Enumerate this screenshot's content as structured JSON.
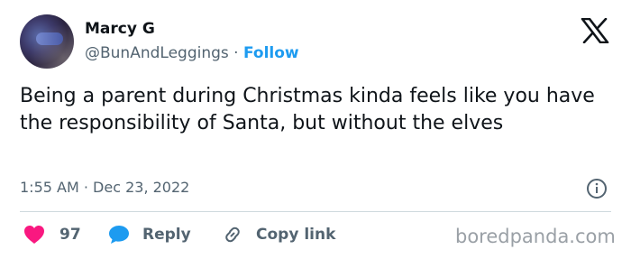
{
  "author": {
    "name": "Marcy G",
    "handle": "@BunAndLeggings",
    "separator": "·",
    "follow_label": "Follow"
  },
  "tweet": {
    "text": "Being a parent during Christmas kinda feels like you have the responsibility of Santa, but without the elves",
    "time": "1:55 AM",
    "date": "Dec 23, 2022",
    "meta_separator": "·"
  },
  "actions": {
    "likes_count": "97",
    "reply_label": "Reply",
    "copy_link_label": "Copy link"
  },
  "watermark": "boredpanda.com",
  "icons": {
    "logo": "x-logo-icon",
    "info": "info-icon",
    "like": "heart-icon",
    "reply": "speech-bubble-icon",
    "copy": "link-icon"
  },
  "colors": {
    "text": "#0f1419",
    "secondary": "#536471",
    "follow": "#1d9bf0",
    "heart": "#f91880",
    "reply_bubble": "#1d9bf0",
    "watermark": "#9aa0a6"
  }
}
